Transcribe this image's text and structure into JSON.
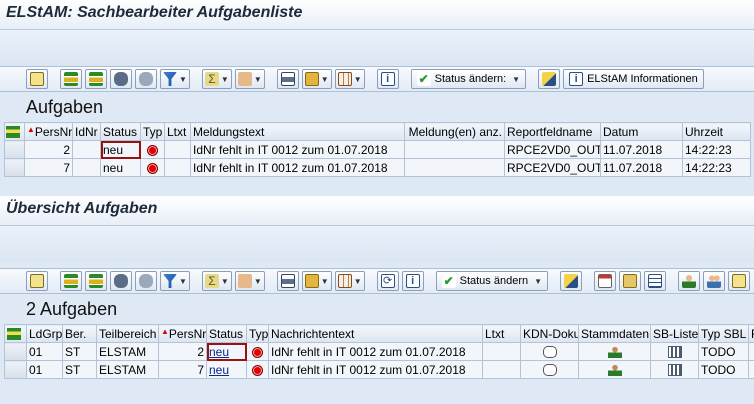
{
  "panel1": {
    "title": "ELStAM: Sachbearbeiter Aufgabenliste",
    "toolbar": {
      "status_label": "Status ändern:",
      "info_label": "ELStAM Informationen"
    },
    "heading": "Aufgaben",
    "columns": [
      "PersNr",
      "IdNr",
      "Status",
      "Typ",
      "Ltxt",
      "Meldungstext",
      "Meldung(en) anz.",
      "Reportfeldname",
      "Datum",
      "Uhrzeit"
    ],
    "rows": [
      {
        "persnr": "2",
        "idnr": "",
        "status": "neu",
        "typ": "red",
        "ltxt": "",
        "meldungstext": "IdNr fehlt in IT 0012 zum 01.07.2018",
        "anz": "",
        "report": "RPCE2VD0_OUT",
        "datum": "11.07.2018",
        "uhrzeit": "14:22:23"
      },
      {
        "persnr": "7",
        "idnr": "",
        "status": "neu",
        "typ": "red",
        "ltxt": "",
        "meldungstext": "IdNr fehlt in IT 0012 zum 01.07.2018",
        "anz": "",
        "report": "RPCE2VD0_OUT",
        "datum": "11.07.2018",
        "uhrzeit": "14:22:23"
      }
    ]
  },
  "panel2": {
    "title": "Übersicht Aufgaben",
    "toolbar": {
      "status_label": "Status ändern"
    },
    "heading": "2 Aufgaben",
    "columns": [
      "LdGrp",
      "Ber.",
      "Teilbereich",
      "PersNr",
      "Status",
      "Typ",
      "Nachrichtentext",
      "Ltxt",
      "KDN-Doku",
      "Stammdaten",
      "SB-Liste",
      "Typ SBL",
      "F"
    ],
    "rows": [
      {
        "ldgrp": "01",
        "ber": "ST",
        "teil": "ELSTAM",
        "persnr": "2",
        "status": "neu",
        "text": "IdNr fehlt in IT 0012 zum 01.07.2018",
        "typsbl": "TODO"
      },
      {
        "ldgrp": "01",
        "ber": "ST",
        "teil": "ELSTAM",
        "persnr": "7",
        "status": "neu",
        "text": "IdNr fehlt in IT 0012 zum 01.07.2018",
        "typsbl": "TODO"
      }
    ]
  },
  "colors": {
    "status_red": "#e30000",
    "highlight": "#9a1111",
    "link": "#0a2a8a"
  }
}
